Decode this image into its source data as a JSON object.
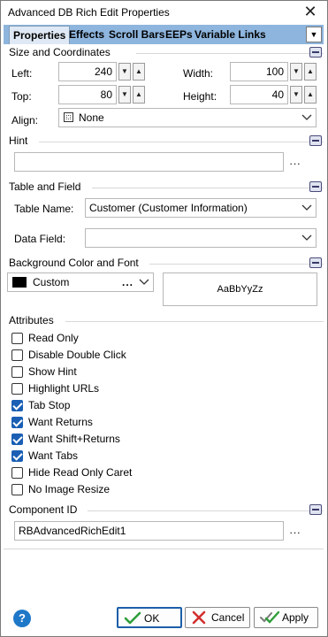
{
  "window": {
    "title": "Advanced DB Rich Edit Properties"
  },
  "tabs": [
    {
      "label": "Properties",
      "active": true
    },
    {
      "label": "Effects"
    },
    {
      "label": "Scroll Bars"
    },
    {
      "label": "EEPs"
    },
    {
      "label": "Variable Links"
    }
  ],
  "size_coords": {
    "title": "Size and Coordinates",
    "left_label": "Left:",
    "left_value": "240",
    "width_label": "Width:",
    "width_value": "100",
    "top_label": "Top:",
    "top_value": "80",
    "height_label": "Height:",
    "height_value": "40",
    "align_label": "Align:",
    "align_value": "None"
  },
  "hint": {
    "title": "Hint",
    "value": "",
    "ellipsis": "..."
  },
  "table_field": {
    "title": "Table and Field",
    "table_label": "Table Name:",
    "table_value": "Customer  (Customer Information)",
    "field_label": "Data Field:",
    "field_value": ""
  },
  "bg_font": {
    "title": "Background Color and Font",
    "color_value": "Custom",
    "color_swatch": "#000000",
    "ellipsis": "...",
    "font_sample": "AaBbYyZz"
  },
  "attributes": {
    "title": "Attributes",
    "items": [
      {
        "label": "Read Only",
        "checked": false
      },
      {
        "label": "Disable Double Click",
        "checked": false
      },
      {
        "label": "Show Hint",
        "checked": false
      },
      {
        "label": "Highlight URLs",
        "checked": false
      },
      {
        "label": "Tab Stop",
        "checked": true
      },
      {
        "label": "Want Returns",
        "checked": true
      },
      {
        "label": "Want Shift+Returns",
        "checked": true
      },
      {
        "label": "Want Tabs",
        "checked": true
      },
      {
        "label": "Hide Read Only Caret",
        "checked": false
      },
      {
        "label": "No Image Resize",
        "checked": false
      }
    ]
  },
  "component": {
    "title": "Component ID",
    "value": "RBAdvancedRichEdit1",
    "ellipsis": "..."
  },
  "footer": {
    "help": "?",
    "ok_label": "OK",
    "cancel_label": "Cancel",
    "apply_label": "Apply"
  },
  "colors": {
    "tab_strip": "#8eb5dd",
    "accent": "#1a5fb4",
    "ok_green": "#2e9e3a",
    "cancel_red": "#d32f2f"
  }
}
